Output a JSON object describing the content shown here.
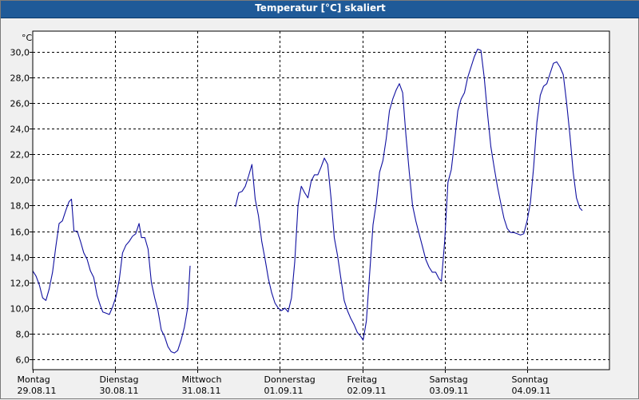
{
  "window": {
    "title": "Temperatur [°C] skaliert"
  },
  "chart_data": {
    "type": "line",
    "title": "Temperatur [°C] skaliert",
    "ylabel": "°C",
    "xlabel": "",
    "ylim": [
      5.2,
      31.6
    ],
    "xlim": [
      0,
      7.0
    ],
    "grid": true,
    "y_ticks": [
      6.0,
      8.0,
      10.0,
      12.0,
      14.0,
      16.0,
      18.0,
      20.0,
      22.0,
      24.0,
      26.0,
      28.0,
      30.0
    ],
    "y_tick_labels": [
      "6,0",
      "8,0",
      "10,0",
      "12,0",
      "14,0",
      "16,0",
      "18,0",
      "20,0",
      "22,0",
      "24,0",
      "26,0",
      "28,0",
      "30,0"
    ],
    "x_ticks": [
      {
        "x": 0,
        "day": "Montag",
        "date": "29.08.11"
      },
      {
        "x": 1,
        "day": "Dienstag",
        "date": "30.08.11"
      },
      {
        "x": 2,
        "day": "Mittwoch",
        "date": "31.08.11"
      },
      {
        "x": 3,
        "day": "Donnerstag",
        "date": "01.09.11"
      },
      {
        "x": 4,
        "day": "Freitag",
        "date": "02.09.11"
      },
      {
        "x": 5,
        "day": "Samstag",
        "date": "03.09.11"
      },
      {
        "x": 6,
        "day": "Sonntag",
        "date": "04.09.11"
      }
    ],
    "line_color": "#1010a0",
    "segments": [
      [
        [
          0.0,
          12.9
        ],
        [
          0.04,
          12.5
        ],
        [
          0.08,
          11.8
        ],
        [
          0.12,
          10.8
        ],
        [
          0.16,
          10.6
        ],
        [
          0.2,
          11.5
        ],
        [
          0.24,
          12.8
        ],
        [
          0.28,
          14.8
        ],
        [
          0.32,
          16.6
        ],
        [
          0.36,
          16.8
        ],
        [
          0.4,
          17.6
        ],
        [
          0.44,
          18.3
        ],
        [
          0.47,
          18.5
        ],
        [
          0.5,
          16.0
        ],
        [
          0.54,
          16.0
        ],
        [
          0.58,
          15.2
        ],
        [
          0.62,
          14.3
        ],
        [
          0.66,
          13.8
        ],
        [
          0.7,
          12.9
        ],
        [
          0.74,
          12.4
        ],
        [
          0.78,
          11.0
        ],
        [
          0.82,
          10.2
        ],
        [
          0.85,
          9.7
        ],
        [
          0.89,
          9.6
        ],
        [
          0.93,
          9.5
        ],
        [
          0.97,
          10.1
        ],
        [
          1.01,
          10.9
        ],
        [
          1.05,
          12.2
        ],
        [
          1.09,
          14.3
        ],
        [
          1.13,
          14.9
        ],
        [
          1.17,
          15.2
        ],
        [
          1.21,
          15.6
        ],
        [
          1.25,
          15.8
        ],
        [
          1.29,
          16.6
        ],
        [
          1.32,
          15.5
        ],
        [
          1.36,
          15.5
        ],
        [
          1.4,
          14.6
        ],
        [
          1.44,
          12.0
        ],
        [
          1.48,
          10.8
        ],
        [
          1.52,
          9.8
        ],
        [
          1.56,
          8.3
        ],
        [
          1.6,
          7.8
        ],
        [
          1.64,
          7.0
        ],
        [
          1.68,
          6.6
        ],
        [
          1.72,
          6.5
        ],
        [
          1.76,
          6.7
        ],
        [
          1.8,
          7.5
        ],
        [
          1.84,
          8.5
        ],
        [
          1.88,
          10.0
        ],
        [
          1.91,
          13.3
        ]
      ],
      [
        [
          2.46,
          17.9
        ],
        [
          2.5,
          19.0
        ],
        [
          2.54,
          19.1
        ],
        [
          2.58,
          19.5
        ],
        [
          2.62,
          20.3
        ],
        [
          2.66,
          21.2
        ],
        [
          2.7,
          18.5
        ],
        [
          2.74,
          17.2
        ],
        [
          2.78,
          15.2
        ],
        [
          2.82,
          13.8
        ],
        [
          2.86,
          12.3
        ],
        [
          2.9,
          11.2
        ],
        [
          2.94,
          10.4
        ],
        [
          2.98,
          10.0
        ],
        [
          3.02,
          9.8
        ],
        [
          3.06,
          10.0
        ],
        [
          3.1,
          9.7
        ],
        [
          3.14,
          10.8
        ],
        [
          3.18,
          13.6
        ],
        [
          3.22,
          18.0
        ],
        [
          3.26,
          19.5
        ],
        [
          3.3,
          19.0
        ],
        [
          3.34,
          18.6
        ],
        [
          3.38,
          19.9
        ],
        [
          3.42,
          20.4
        ],
        [
          3.46,
          20.4
        ],
        [
          3.5,
          21.0
        ],
        [
          3.54,
          21.7
        ],
        [
          3.58,
          21.2
        ],
        [
          3.62,
          18.6
        ],
        [
          3.66,
          15.5
        ],
        [
          3.7,
          14.1
        ],
        [
          3.74,
          12.3
        ],
        [
          3.78,
          10.6
        ],
        [
          3.82,
          9.8
        ],
        [
          3.86,
          9.2
        ],
        [
          3.9,
          8.7
        ],
        [
          3.94,
          8.1
        ],
        [
          3.98,
          7.8
        ],
        [
          4.01,
          7.5
        ],
        [
          4.05,
          9.0
        ],
        [
          4.09,
          12.8
        ],
        [
          4.13,
          16.5
        ],
        [
          4.17,
          18.2
        ],
        [
          4.21,
          20.6
        ],
        [
          4.25,
          21.5
        ],
        [
          4.29,
          23.2
        ],
        [
          4.33,
          25.4
        ],
        [
          4.37,
          26.3
        ],
        [
          4.41,
          27.0
        ],
        [
          4.45,
          27.5
        ],
        [
          4.49,
          26.8
        ],
        [
          4.53,
          23.5
        ],
        [
          4.57,
          20.6
        ],
        [
          4.61,
          18.0
        ],
        [
          4.65,
          16.8
        ],
        [
          4.69,
          15.8
        ],
        [
          4.73,
          14.8
        ],
        [
          4.77,
          13.8
        ],
        [
          4.81,
          13.2
        ],
        [
          4.85,
          12.8
        ],
        [
          4.89,
          12.8
        ],
        [
          4.93,
          12.3
        ],
        [
          4.96,
          12.1
        ],
        [
          5.0,
          15.2
        ],
        [
          5.04,
          19.8
        ],
        [
          5.08,
          20.8
        ],
        [
          5.12,
          23.0
        ],
        [
          5.16,
          25.4
        ],
        [
          5.2,
          26.3
        ],
        [
          5.24,
          26.8
        ],
        [
          5.28,
          28.0
        ],
        [
          5.32,
          28.8
        ],
        [
          5.36,
          29.6
        ],
        [
          5.4,
          30.2
        ],
        [
          5.44,
          30.1
        ],
        [
          5.48,
          28.0
        ],
        [
          5.52,
          25.2
        ],
        [
          5.56,
          22.6
        ],
        [
          5.6,
          21.0
        ],
        [
          5.64,
          19.5
        ],
        [
          5.68,
          18.2
        ],
        [
          5.72,
          17.0
        ],
        [
          5.76,
          16.2
        ],
        [
          5.8,
          15.9
        ],
        [
          5.84,
          15.9
        ],
        [
          5.88,
          15.8
        ],
        [
          5.92,
          15.7
        ],
        [
          5.96,
          15.8
        ],
        [
          6.0,
          16.8
        ],
        [
          6.04,
          18.2
        ],
        [
          6.08,
          21.0
        ],
        [
          6.12,
          24.5
        ],
        [
          6.16,
          26.6
        ],
        [
          6.2,
          27.3
        ],
        [
          6.24,
          27.5
        ],
        [
          6.28,
          28.3
        ],
        [
          6.32,
          29.1
        ],
        [
          6.36,
          29.2
        ],
        [
          6.4,
          28.8
        ],
        [
          6.44,
          28.2
        ],
        [
          6.48,
          26.0
        ],
        [
          6.52,
          23.5
        ],
        [
          6.56,
          20.6
        ],
        [
          6.6,
          18.6
        ],
        [
          6.64,
          17.8
        ],
        [
          6.67,
          17.6
        ]
      ]
    ]
  }
}
